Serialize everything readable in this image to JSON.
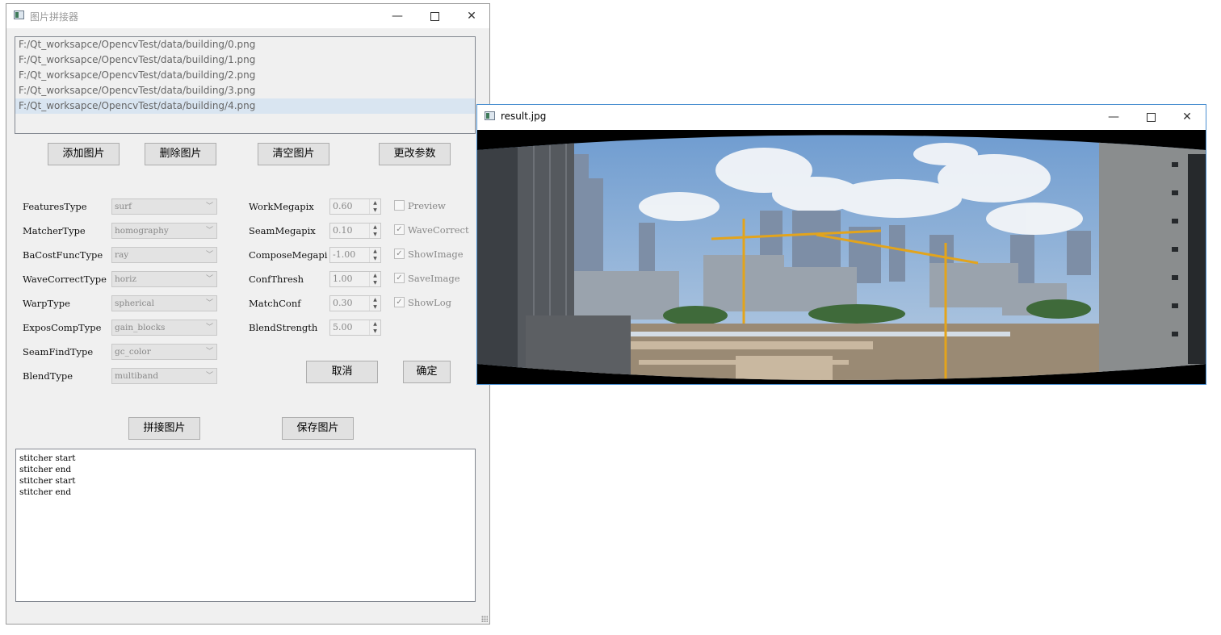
{
  "main_window": {
    "title": "图片拼接器",
    "controls": {
      "minimize": "—",
      "maximize": "☐",
      "close": "✕"
    }
  },
  "file_list": [
    "F:/Qt_worksapce/OpencvTest/data/building/0.png",
    "F:/Qt_worksapce/OpencvTest/data/building/1.png",
    "F:/Qt_worksapce/OpencvTest/data/building/2.png",
    "F:/Qt_worksapce/OpencvTest/data/building/3.png",
    "F:/Qt_worksapce/OpencvTest/data/building/4.png"
  ],
  "buttons": {
    "add": "添加图片",
    "delete": "删除图片",
    "clear": "清空图片",
    "change_params": "更改参数",
    "cancel": "取消",
    "ok": "确定",
    "stitch": "拼接图片",
    "save": "保存图片"
  },
  "params": {
    "features_type": {
      "label": "FeaturesType",
      "value": "surf"
    },
    "matcher_type": {
      "label": "MatcherType",
      "value": "homography"
    },
    "ba_cost_func_type": {
      "label": "BaCostFuncType",
      "value": "ray"
    },
    "wave_correct_type": {
      "label": "WaveCorrectType",
      "value": "horiz"
    },
    "warp_type": {
      "label": "WarpType",
      "value": "spherical"
    },
    "expos_comp_type": {
      "label": "ExposCompType",
      "value": "gain_blocks"
    },
    "seam_find_type": {
      "label": "SeamFindType",
      "value": "gc_color"
    },
    "blend_type": {
      "label": "BlendType",
      "value": "multiband"
    }
  },
  "numeric": {
    "work_megapix": {
      "label": "WorkMegapix",
      "value": "0.60"
    },
    "seam_megapix": {
      "label": "SeamMegapix",
      "value": "0.10"
    },
    "compose_megapix": {
      "label": "ComposeMegapi",
      "value": "-1.00"
    },
    "conf_thresh": {
      "label": "ConfThresh",
      "value": "1.00"
    },
    "match_conf": {
      "label": "MatchConf",
      "value": "0.30"
    },
    "blend_strength": {
      "label": "BlendStrength",
      "value": "5.00"
    }
  },
  "checks": {
    "preview": {
      "label": "Preview",
      "checked": false
    },
    "wave_correct": {
      "label": "WaveCorrect",
      "checked": true
    },
    "show_image": {
      "label": "ShowImage",
      "checked": true
    },
    "save_image": {
      "label": "SaveImage",
      "checked": true
    },
    "show_log": {
      "label": "ShowLog",
      "checked": true
    }
  },
  "log": [
    "stitcher start",
    "stitcher end",
    "stitcher start",
    "stitcher end"
  ],
  "result_window": {
    "title": "result.jpg",
    "controls": {
      "minimize": "—",
      "maximize": "☐",
      "close": "✕"
    }
  },
  "colors": {
    "sky": "#8fb4dc",
    "selection": "#d9e5f1",
    "accent_border": "#4a8fd0"
  }
}
